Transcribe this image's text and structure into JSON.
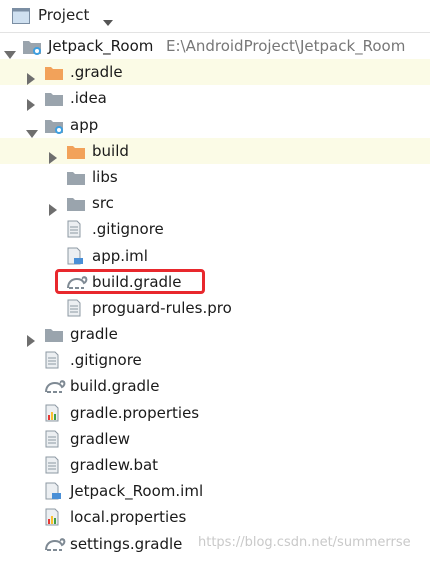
{
  "header": {
    "title": "Project",
    "dropdown_icon": "chevron-down-icon",
    "view_icon": "window-icon"
  },
  "tree": [
    {
      "label": "Jetpack_Room",
      "path": "E:\\AndroidProject\\Jetpack_Room",
      "icon": "module-folder-icon",
      "arrow": "down",
      "indent": 0
    },
    {
      "label": ".gradle",
      "icon": "folder-orange-icon",
      "arrow": "right",
      "indent": 1,
      "highlight": true
    },
    {
      "label": ".idea",
      "icon": "folder-gray-icon",
      "arrow": "right",
      "indent": 1
    },
    {
      "label": "app",
      "icon": "module-folder-icon",
      "arrow": "down",
      "indent": 1
    },
    {
      "label": "build",
      "icon": "folder-orange-icon",
      "arrow": "right",
      "indent": 2,
      "highlight": true
    },
    {
      "label": "libs",
      "icon": "folder-gray-icon",
      "arrow": "none",
      "indent": 2
    },
    {
      "label": "src",
      "icon": "folder-gray-icon",
      "arrow": "right",
      "indent": 2
    },
    {
      "label": ".gitignore",
      "icon": "file-icon",
      "arrow": "none",
      "indent": 2
    },
    {
      "label": "app.iml",
      "icon": "iml-file-icon",
      "arrow": "none",
      "indent": 2
    },
    {
      "label": "build.gradle",
      "icon": "gradle-icon",
      "arrow": "none",
      "indent": 2,
      "selected": true
    },
    {
      "label": "proguard-rules.pro",
      "icon": "file-icon",
      "arrow": "none",
      "indent": 2
    },
    {
      "label": "gradle",
      "icon": "folder-gray-icon",
      "arrow": "right",
      "indent": 1
    },
    {
      "label": ".gitignore",
      "icon": "file-icon",
      "arrow": "none",
      "indent": 1
    },
    {
      "label": "build.gradle",
      "icon": "gradle-icon",
      "arrow": "none",
      "indent": 1
    },
    {
      "label": "gradle.properties",
      "icon": "properties-file-icon",
      "arrow": "none",
      "indent": 1
    },
    {
      "label": "gradlew",
      "icon": "file-icon",
      "arrow": "none",
      "indent": 1
    },
    {
      "label": "gradlew.bat",
      "icon": "file-icon",
      "arrow": "none",
      "indent": 1
    },
    {
      "label": "Jetpack_Room.iml",
      "icon": "iml-file-icon",
      "arrow": "none",
      "indent": 1
    },
    {
      "label": "local.properties",
      "icon": "properties-file-icon",
      "arrow": "none",
      "indent": 1
    },
    {
      "label": "settings.gradle",
      "icon": "gradle-icon",
      "arrow": "none",
      "indent": 1
    }
  ],
  "colors": {
    "highlight_row": "#fbfbe6",
    "selection_box": "#e8282d",
    "folder_orange": "#f2a25a",
    "folder_gray": "#9aa4ad"
  },
  "watermark": "https://blog.csdn.net/summerrse"
}
